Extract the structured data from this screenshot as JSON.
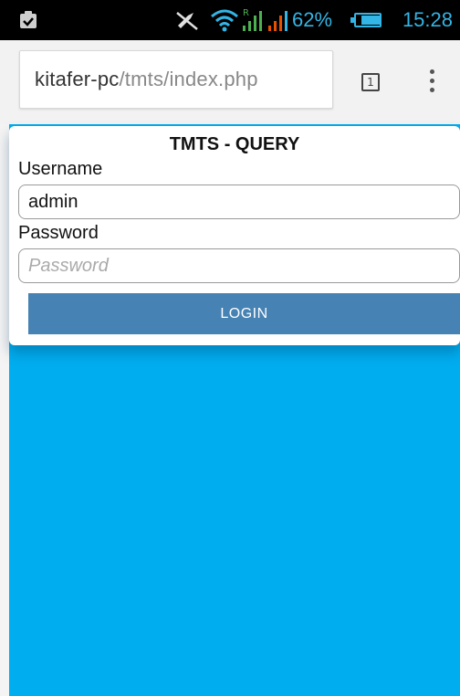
{
  "status_bar": {
    "battery_percent": "62%",
    "time": "15:28",
    "icons": [
      "clipboard-icon",
      "mute-icon",
      "wifi-icon",
      "signal-icon",
      "signal-icon",
      "battery-icon"
    ]
  },
  "browser": {
    "url_host": "kitafer-pc",
    "url_path": "/tmts/index.php",
    "tab_count": "1"
  },
  "form": {
    "title": "TMTS - QUERY",
    "username_label": "Username",
    "username_value": "admin",
    "password_label": "Password",
    "password_placeholder": "Password",
    "login_label": "LOGIN"
  },
  "colors": {
    "page_background": "#00adef",
    "button": "#4682b4",
    "status_accent": "#33b5e5"
  }
}
